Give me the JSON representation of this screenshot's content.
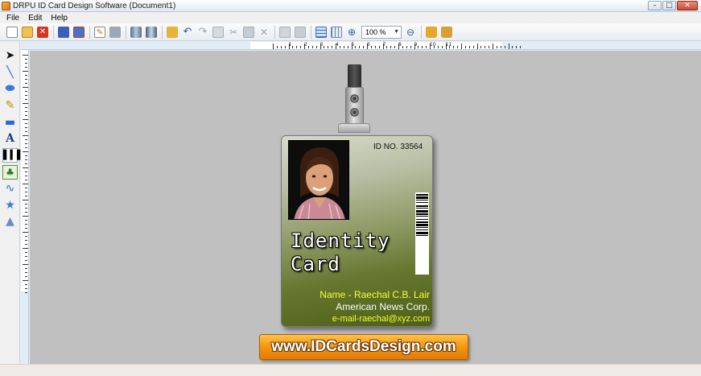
{
  "window": {
    "title": "DRPU ID Card Design Software  (Document1)",
    "controls": {
      "minimize": "–",
      "maximize": "□",
      "close": "✕"
    }
  },
  "menu": {
    "items": [
      "File",
      "Edit",
      "Help"
    ]
  },
  "toolbar": {
    "zoom_value": "100 %",
    "buttons": [
      "new-icon",
      "open-icon",
      "close-doc-icon",
      "save-icon",
      "save-as-icon",
      "edit-icon",
      "print-icon",
      "database-icon",
      "database-multi-icon",
      "open-folder-icon",
      "undo-icon",
      "redo-icon",
      "copy-icon",
      "cut-icon",
      "paste-icon",
      "delete-icon",
      "bring-front-icon",
      "send-back-icon",
      "grid-icon",
      "grid-dots-icon",
      "zoom-in-icon",
      "zoom-out-icon",
      "lock-icon",
      "unlock-icon"
    ]
  },
  "left_tools": [
    "pointer-icon",
    "line-icon",
    "ellipse-icon",
    "pencil-icon",
    "rectangle-icon",
    "text-icon",
    "barcode-icon",
    "image-icon",
    "curve-icon",
    "star-icon",
    "triangle-icon"
  ],
  "ruler": {
    "top_numbers": [
      "1",
      "2",
      "3",
      "4",
      "5",
      "6",
      "7",
      "8",
      "9",
      "10",
      "11"
    ]
  },
  "card": {
    "id_no": "ID NO. 33564",
    "title_line1": "Identity",
    "title_line2": "Card",
    "name": "Name - Raechal C.B. Lair",
    "company": "American News Corp.",
    "email": "e-mail-raechal@xyz.com"
  },
  "banner": {
    "text": "www.IDCardsDesign.com"
  },
  "colors": {
    "canvas": "#c0c0c0",
    "card_top": "#d7dacb",
    "card_bottom": "#4e6017",
    "card_accent_text": "#f4ff3a",
    "banner_orange": "#f49a12"
  }
}
